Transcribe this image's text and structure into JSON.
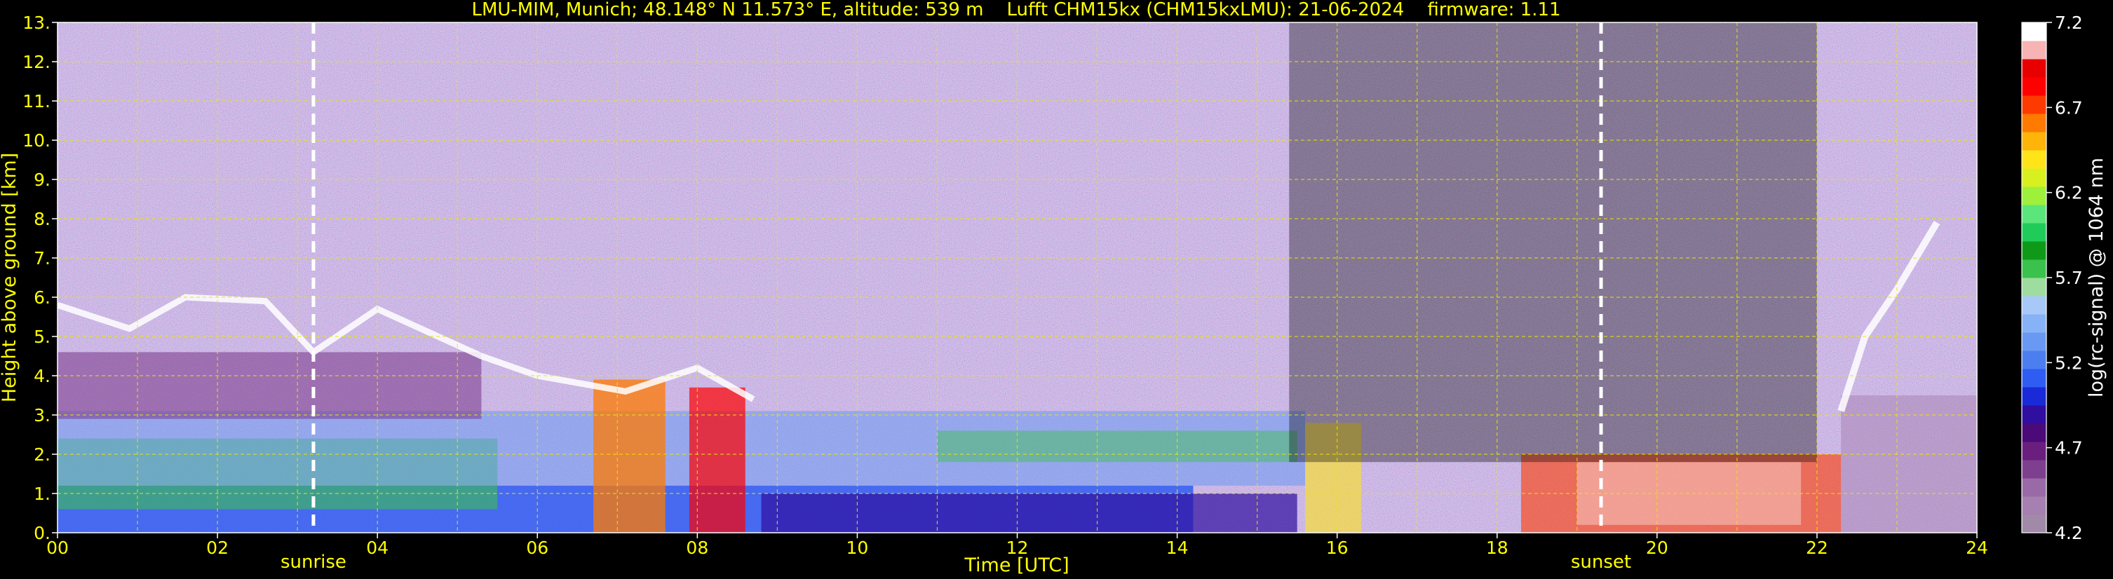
{
  "chart_data": {
    "type": "heatmap",
    "title": "LMU-MIM, Munich; 48.148° N 11.573° E, altitude: 539 m    Lufft CHM15kx (CHM15kxLMU): 21-06-2024    firmware: 1.11",
    "xlabel": "Time [UTC]",
    "ylabel": "Height above ground [km]",
    "xlim": [
      0,
      24
    ],
    "ylim": [
      0,
      13
    ],
    "x_ticks": [
      "00",
      "02",
      "04",
      "06",
      "08",
      "10",
      "12",
      "14",
      "16",
      "18",
      "20",
      "22",
      "24"
    ],
    "y_ticks": [
      "0.",
      "1.",
      "2.",
      "3.",
      "4.",
      "5.",
      "6.",
      "7.",
      "8.",
      "9.",
      "10.",
      "11.",
      "12.",
      "13."
    ],
    "grid": true,
    "annotations": [
      {
        "label": "sunrise",
        "x": 3.2
      },
      {
        "label": "sunset",
        "x": 19.3
      }
    ],
    "colorbar": {
      "label": "log(rc-signal) @ 1064 nm",
      "range": [
        4.2,
        7.2
      ],
      "ticks": [
        "4.2",
        "4.7",
        "5.2",
        "5.7",
        "6.2",
        "6.7",
        "7.2"
      ],
      "colors": [
        "#a08aa8",
        "#a580b0",
        "#9a6aa6",
        "#7f3f8f",
        "#6a1f7f",
        "#4b0a78",
        "#2f0ea0",
        "#1a2ad8",
        "#2f5cf2",
        "#4c7ef0",
        "#6a99f3",
        "#87b2f5",
        "#a8c9f7",
        "#9fdca0",
        "#3ac24c",
        "#0e9a18",
        "#1fcc5a",
        "#5ae67a",
        "#9ef03a",
        "#d8f020",
        "#ffe41a",
        "#ffb40a",
        "#ff7a00",
        "#ff3a00",
        "#ff0000",
        "#e80000",
        "#f8b4b4",
        "#ffffff"
      ]
    }
  }
}
